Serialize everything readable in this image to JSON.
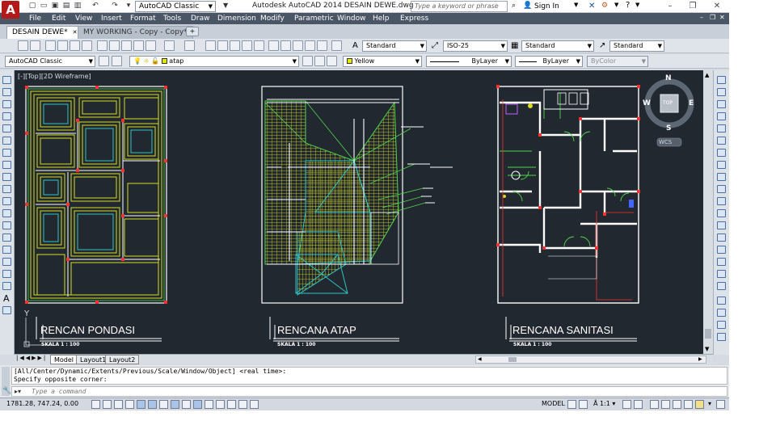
{
  "app": {
    "title": "Autodesk AutoCAD 2014    DESAIN DEWE.dwg",
    "workspace": "AutoCAD Classic",
    "search_placeholder": "Type a keyword or phrase",
    "sign_in": "Sign In"
  },
  "menu": [
    "File",
    "Edit",
    "View",
    "Insert",
    "Format",
    "Tools",
    "Draw",
    "Dimension",
    "Modify",
    "Parametric",
    "Window",
    "Help",
    "Express"
  ],
  "tabs": [
    {
      "label": "DESAIN DEWE*",
      "active": true
    },
    {
      "label": "MY WORKING - Copy - Copy*",
      "active": false
    }
  ],
  "styles": {
    "text_style": "Standard",
    "dim_style": "ISO-25",
    "table_style": "Standard",
    "mleader_style": "Standard"
  },
  "layers": {
    "workspace": "AutoCAD Classic",
    "current_layer": "atap",
    "color": "Yellow",
    "linetype": "ByLayer",
    "lineweight": "ByLayer",
    "plotstyle": "ByColor"
  },
  "viewport": {
    "label": "[-][Top][2D Wireframe]"
  },
  "viewcube": {
    "north": "N",
    "south": "S",
    "east": "E",
    "west": "W",
    "top": "TOP",
    "ucs": "WCS"
  },
  "drawings": [
    {
      "title": "RENCAN PONDASI",
      "scale": "SKALA 1 : 100"
    },
    {
      "title": "RENCANA ATAP",
      "scale": "SKALA 1 : 100"
    },
    {
      "title": "RENCANA SANITASI",
      "scale": "SKALA 1 : 100"
    }
  ],
  "layout_tabs": [
    "Model",
    "Layout1",
    "Layout2"
  ],
  "command": {
    "line1": "[All/Center/Dynamic/Extents/Previous/Scale/Window/Object] <real time>:",
    "line2": "Specify opposite corner:",
    "placeholder": "Type a command"
  },
  "status": {
    "coords": "1781.28, 747.24, 0.00",
    "model": "MODEL",
    "scale": "1:1"
  },
  "colors": {
    "drawing_bg": "#212830",
    "wall": "#ffffff",
    "hatch": "#d6dc1e",
    "foundation_green": "#4fd64a",
    "cyan": "#2ec4c4",
    "red": "#ff3030",
    "menu_bg": "#4a5566"
  }
}
